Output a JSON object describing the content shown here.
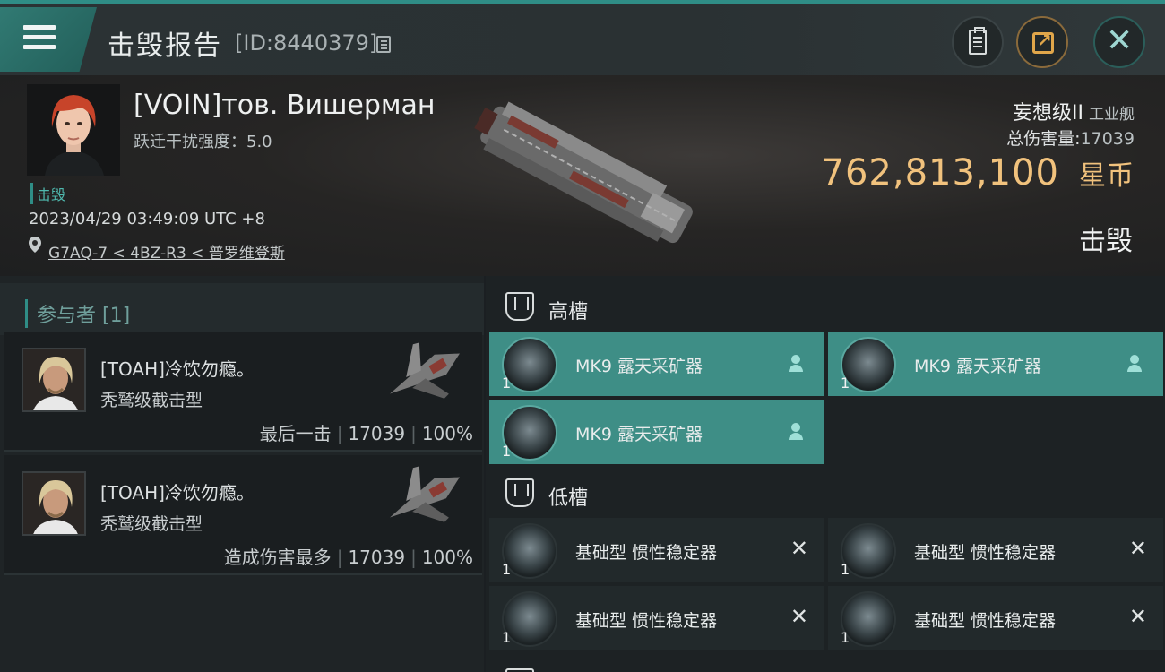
{
  "header": {
    "title": "击毁报告",
    "report_id": "[ID:8440379]"
  },
  "victim": {
    "name": "[VOIN]тов. Вишерман",
    "warp_label": "跃迁干扰强度：",
    "warp_value": "5.0",
    "status": "击毁",
    "datetime": "2023/04/29 03:49:09 UTC +8",
    "location": "G7AQ-7 < 4BZ-R3 < 普罗维登斯",
    "ship_class": "妄想级II",
    "ship_type": "工业舰",
    "total_damage_label": "总伤害量:",
    "total_damage": "17039",
    "isk_value": "762,813,100",
    "isk_unit": "星币",
    "result": "击毁"
  },
  "participants": {
    "title": "参与者 [1]",
    "items": [
      {
        "name": "[TOAH]冷饮勿瘾。",
        "ship": "秃鹫级截击型",
        "role": "最后一击",
        "damage": "17039",
        "percent": "100%"
      },
      {
        "name": "[TOAH]冷饮勿瘾。",
        "ship": "秃鹫级截击型",
        "role": "造成伤害最多",
        "damage": "17039",
        "percent": "100%"
      }
    ]
  },
  "fitting": {
    "high_slots_label": "高槽",
    "high_slots": [
      {
        "name": "MK9 露天采矿器",
        "qty": "1",
        "state": "dropped"
      },
      {
        "name": "MK9 露天采矿器",
        "qty": "1",
        "state": "dropped"
      },
      {
        "name": "MK9 露天采矿器",
        "qty": "1",
        "state": "dropped"
      }
    ],
    "low_slots_label": "低槽",
    "low_slots": [
      {
        "name": "基础型 惯性稳定器",
        "qty": "1",
        "state": "destroyed",
        "mark": "✕"
      },
      {
        "name": "基础型 惯性稳定器",
        "qty": "1",
        "state": "destroyed",
        "mark": "✕"
      },
      {
        "name": "基础型 惯性稳定器",
        "qty": "1",
        "state": "destroyed",
        "mark": "✕"
      },
      {
        "name": "基础型 惯性稳定器",
        "qty": "1",
        "state": "destroyed",
        "mark": "✕"
      }
    ]
  },
  "colors": {
    "accent": "#2f8d86",
    "isk": "#f1c27d",
    "active_module": "#3e8e86"
  }
}
